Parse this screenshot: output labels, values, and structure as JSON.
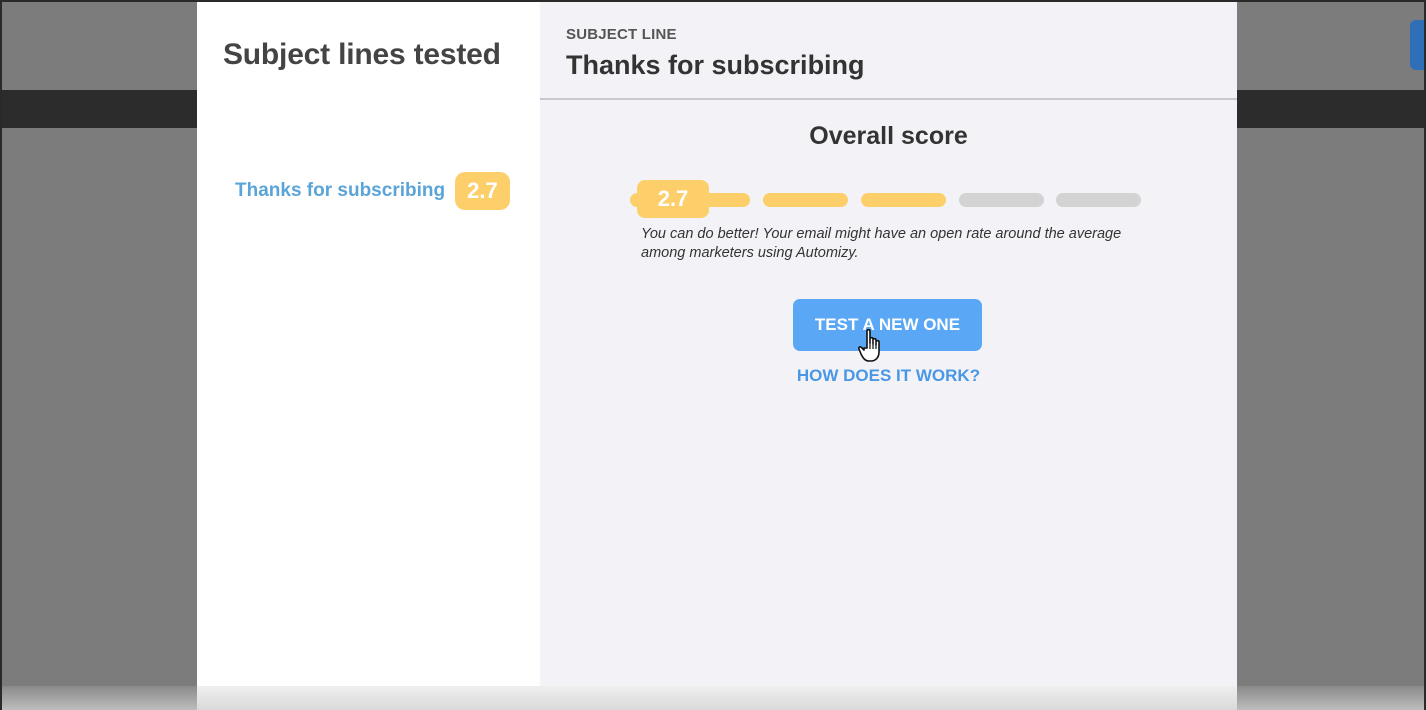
{
  "sidebar": {
    "title": "Subject lines tested",
    "items": [
      {
        "label": "Thanks for subscribing",
        "score": "2.7"
      }
    ]
  },
  "detail": {
    "caption": "SUBJECT LINE",
    "subject": "Thanks for subscribing",
    "overall_title": "Overall score",
    "score": "2.7",
    "score_segments_total": 5,
    "score_segments_filled": 3,
    "feedback": "You can do better! Your email might have an open rate around the average among marketers using Automizy.",
    "test_button": "TEST A NEW ONE",
    "how_link": "HOW DOES IT WORK?"
  },
  "colors": {
    "score_yellow": "#fdcf6b",
    "segment_gray": "#d3d3d3",
    "button_blue": "#5aa8f5",
    "link_blue": "#4a97e6",
    "item_blue": "#5aa4d8"
  },
  "cursor": {
    "icon": "hand-pointer-icon"
  }
}
